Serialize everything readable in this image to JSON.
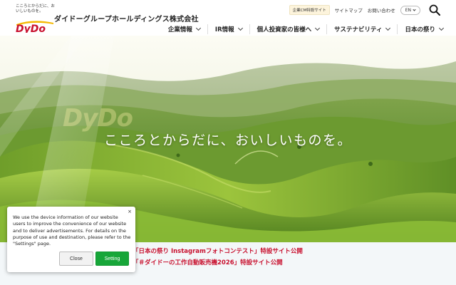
{
  "header": {
    "logo_tagline": "こころとからだに、おいしいものを。",
    "logo_text": "DyDo",
    "company_name": "ダイドーグループホールディングス株式会社",
    "util": {
      "cm_badge": "企業CM特設サイト",
      "sitemap": "サイトマップ",
      "contact": "お問い合わせ",
      "lang": "EN"
    },
    "nav": [
      {
        "label": "企業情報"
      },
      {
        "label": "IR情報"
      },
      {
        "label": "個人投資家の皆様へ"
      },
      {
        "label": "サステナビリティ"
      },
      {
        "label": "日本の祭り"
      }
    ]
  },
  "hero": {
    "copy": "こころとからだに、おいしいものを。",
    "watermark": "DyDo"
  },
  "news": [
    {
      "text": "「日本の祭り Instagramフォトコンテスト」特設サイト公開"
    },
    {
      "text": "「＃ダイドーの工作自動販売機2026」特設サイト公開"
    }
  ],
  "cookie": {
    "close_glyph": "×",
    "message": "We use the device information of our website users to improve the convenience of our website and to deliver advertisements. For details on the purpose of use and destination, please refer to the \"Settings\" page.",
    "close_label": "Close",
    "setting_label": "Setting"
  },
  "colors": {
    "brand_red": "#c8102e",
    "brand_yellow": "#f5b800",
    "setting_green": "#17a639"
  }
}
